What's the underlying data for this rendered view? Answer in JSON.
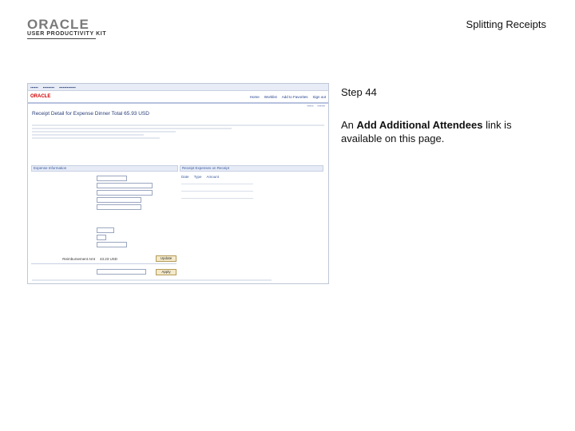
{
  "header": {
    "brand": "ORACLE",
    "product": "USER PRODUCTIVITY KIT",
    "title": "Splitting Receipts"
  },
  "step": {
    "label": "Step 44"
  },
  "instruction": {
    "prefix": "An ",
    "link_text": "Add Additional Attendees",
    "suffix": " link is available on this page."
  },
  "screenshot": {
    "oracle_logo": "ORACLE",
    "receipt_title": "Receipt Detail for Expense Dinner",
    "receipt_total": "Total 65.93 USD",
    "nav_links": [
      "Home",
      "Worklist",
      "Add to Favorites",
      "Sign out"
    ],
    "section_expense": "Expense Information",
    "section_receipts": "Receipt Expenses on Receipt",
    "amount_label": "Reimbursement Amt",
    "amount_value": "43.23 USD",
    "columns": [
      "Date",
      "Type",
      "Amount"
    ],
    "update_button": "Update",
    "apply_button": "Apply"
  }
}
